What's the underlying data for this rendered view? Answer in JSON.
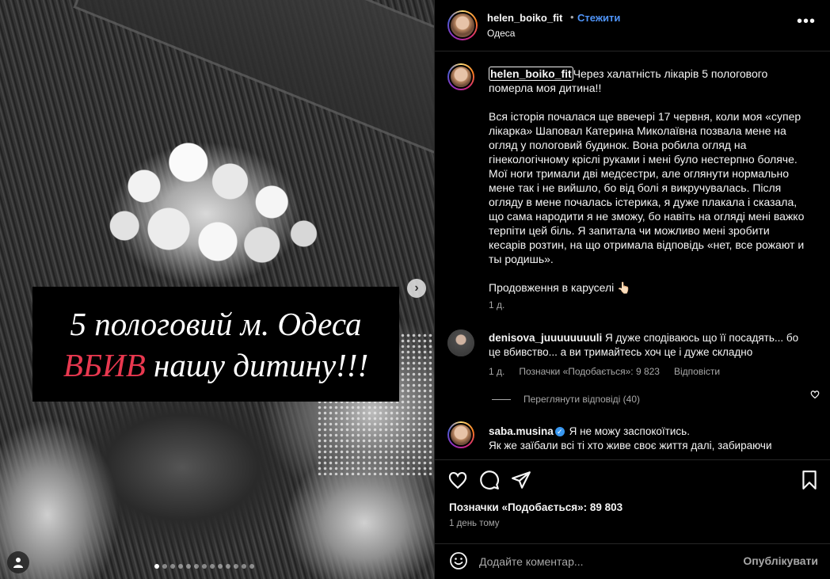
{
  "media": {
    "caption_line1": "5 пологовий м. Одеса",
    "caption_line2_red": "ВБИВ",
    "caption_line2_rest": " нашу дитину!!!",
    "slide_count": 13,
    "active_slide": 1
  },
  "header": {
    "username": "helen_boiko_fit",
    "separator": "•",
    "follow_label": "Стежити",
    "location": "Одеса",
    "more": "•••"
  },
  "post": {
    "username": "helen_boiko_fit",
    "text": "Через халатність лікарів 5 пологового померла моя дитина!!\n\nВся історія почалася ще ввечері 17 червня, коли моя «супер лікарка» Шаповал Катерина Миколаївна позвала мене на огляд у пологовий будинок. Вона робила огляд на гінекологічному кріслі руками і мені було нестерпно боляче. Мої ноги тримали дві медсестри, але оглянути нормально мене так і не вийшло, бо від болі я викручувалась. Після огляду в мене почалась істерика, я дуже плакала і сказала, що сама народити я не зможу, бо навіть на огляді мені важко терпіти цей біль. Я запитала чи можливо мені зробити кесарів розтин, на що отримала відповідь «нет, все рожают и ты родишь».\n\nПродовження в каруселі 👆🏻",
    "time": "1 д."
  },
  "comments": [
    {
      "username": "denisova_juuuuuuuuli",
      "text": "Я дуже сподіваюсь що її посадять... бо це вбивство... а ви тримайтесь хоч це і дуже складно",
      "time": "1 д.",
      "likes": "Позначки «Подобається»: 9 823",
      "reply": "Відповісти",
      "view_replies": "Переглянути відповіді (40)"
    },
    {
      "username": "saba.musina",
      "text": "Я не можу заспокоїтись.",
      "text2": "Як же заїбали всі ті хто живе своє життя далі, забираючи"
    }
  ],
  "actions": {
    "likes": "Позначки «Подобається»: 89 803",
    "posted": "1 день тому"
  },
  "add_comment": {
    "placeholder": "Додайте коментар...",
    "publish": "Опублікувати"
  },
  "colors": {
    "accent": "#4f94f8",
    "caption_red": "#e8384f",
    "background": "#000000",
    "muted": "#a8a8a8"
  }
}
